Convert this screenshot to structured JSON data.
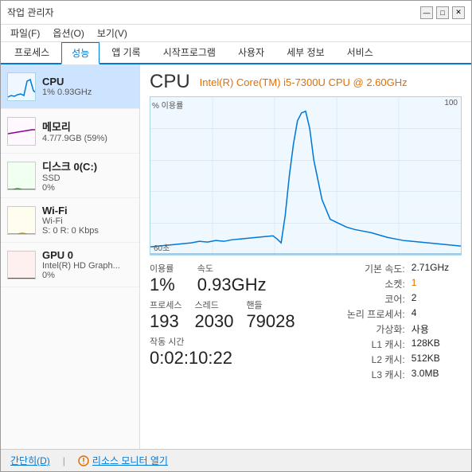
{
  "window": {
    "title": "작업 관리자",
    "controls": {
      "minimize": "—",
      "maximize": "□",
      "close": "✕"
    }
  },
  "menu": {
    "items": [
      "파일(F)",
      "옵션(O)",
      "보기(V)"
    ]
  },
  "tabs": {
    "items": [
      "프로세스",
      "성능",
      "앱 기록",
      "시작프로그램",
      "사용자",
      "세부 정보",
      "서비스"
    ],
    "active": 1
  },
  "sidebar": {
    "items": [
      {
        "name": "CPU",
        "sub1": "1% 0.93GHz",
        "sub2": "",
        "active": true,
        "color": "#0078d7"
      },
      {
        "name": "메모리",
        "sub1": "4.7/7.9GB (59%)",
        "sub2": "",
        "active": false,
        "color": "#8B008B"
      },
      {
        "name": "디스크 0(C:)",
        "sub1": "SSD",
        "sub2": "0%",
        "active": false,
        "color": "#228B22"
      },
      {
        "name": "Wi-Fi",
        "sub1": "Wi-Fi",
        "sub2": "S: 0 R: 0 Kbps",
        "active": false,
        "color": "#B8860B"
      },
      {
        "name": "GPU 0",
        "sub1": "Intel(R) HD Graph...",
        "sub2": "0%",
        "active": false,
        "color": "#8B0000"
      }
    ]
  },
  "main": {
    "title": "CPU",
    "subtitle": "Intel(R) Core(TM) i5-7300U CPU @ 2.60GHz",
    "chart": {
      "y_label": "% 이용률",
      "y_max": "100",
      "x_label": "60초"
    },
    "stats1": {
      "utilization_label": "이용률",
      "utilization_value": "1%",
      "speed_label": "속도",
      "speed_value": "0.93GHz"
    },
    "stats2": {
      "process_label": "프로세스",
      "process_value": "193",
      "thread_label": "스레드",
      "thread_value": "2030",
      "handle_label": "핸들",
      "handle_value": "79028"
    },
    "uptime": {
      "label": "작동 시간",
      "value": "0:02:10:22"
    },
    "right_stats": {
      "items": [
        {
          "label": "기본 속도:",
          "value": "2.71GHz",
          "highlight": false
        },
        {
          "label": "소켓:",
          "value": "1",
          "highlight": true
        },
        {
          "label": "코어:",
          "value": "2",
          "highlight": false
        },
        {
          "label": "논리 프로세서:",
          "value": "4",
          "highlight": false
        },
        {
          "label": "가상화:",
          "value": "사용",
          "highlight": false
        },
        {
          "label": "L1 캐시:",
          "value": "128KB",
          "highlight": false
        },
        {
          "label": "L2 캐시:",
          "value": "512KB",
          "highlight": false
        },
        {
          "label": "L3 캐시:",
          "value": "3.0MB",
          "highlight": false
        }
      ]
    }
  },
  "bottom": {
    "collapse_label": "간단히(D)",
    "monitor_label": "리소스 모니터 열기"
  }
}
